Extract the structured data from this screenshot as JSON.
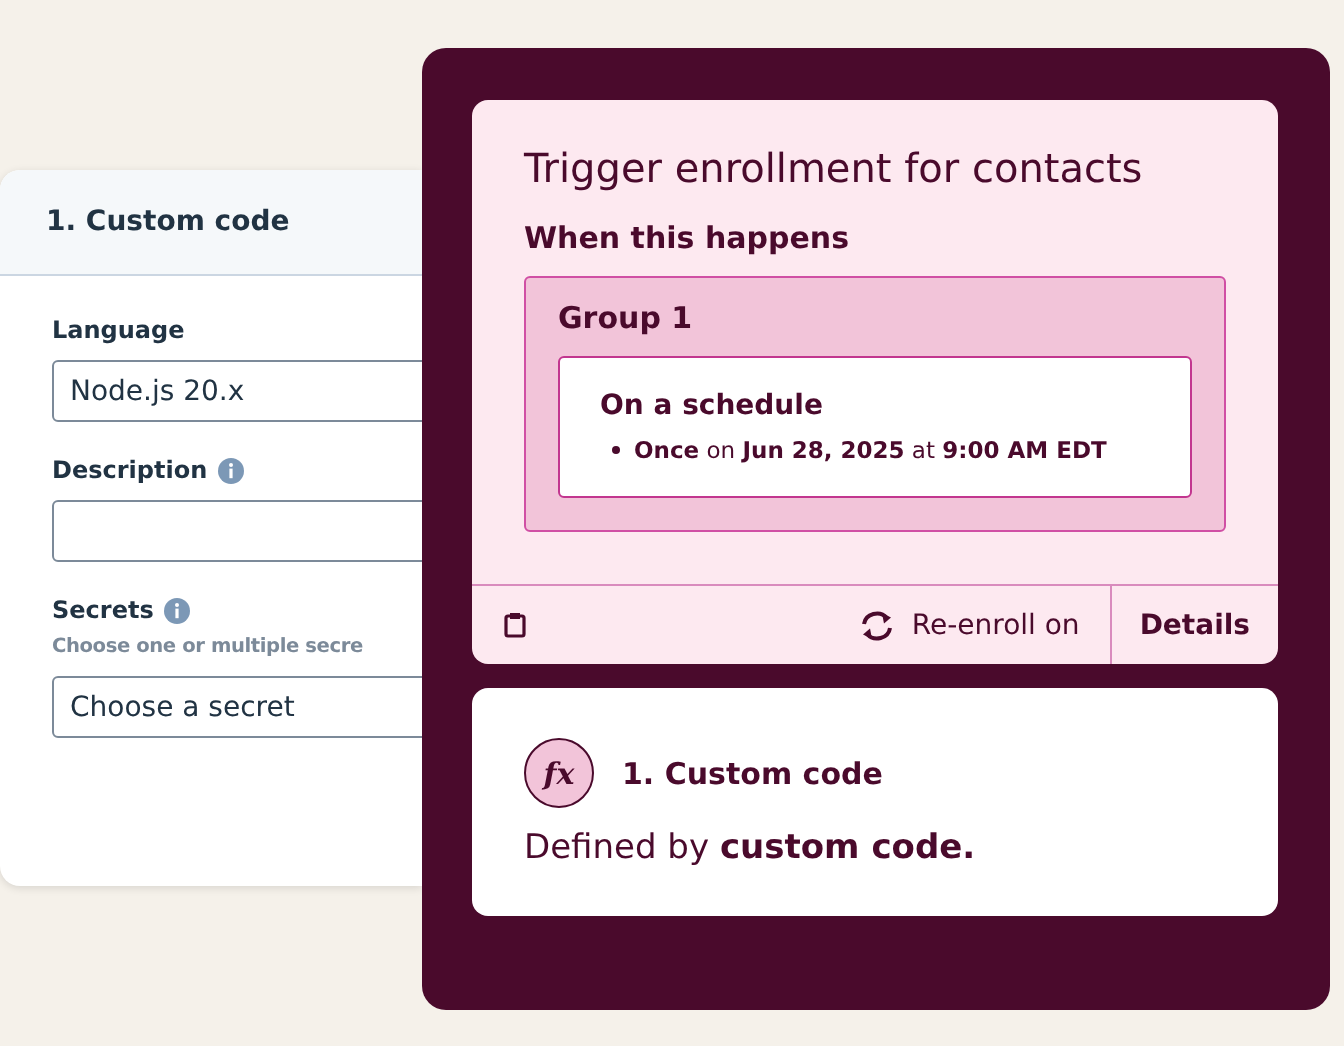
{
  "settings_panel": {
    "title": "1. Custom code",
    "fields": [
      {
        "label": "Language",
        "info": false,
        "value": "Node.js 20.x"
      },
      {
        "label": "Description",
        "info": true
      },
      {
        "label": "Secrets",
        "info": true,
        "hint": "Choose one or multiple secre",
        "value": "Choose a secret"
      }
    ]
  },
  "trigger": {
    "title": "Trigger enrollment for contacts",
    "subtitle": "When this happens",
    "group": {
      "title": "Group 1",
      "condition": {
        "title": "On a schedule",
        "items": [
          "**Once** on **Jun 28, 2025** at **9:00 AM EDT**"
        ]
      }
    },
    "reenroll": "Re-enroll on",
    "details": "Details"
  },
  "action": {
    "icon_text": "fx",
    "title": "1. Custom code",
    "description": "Defined by **custom code.**"
  }
}
